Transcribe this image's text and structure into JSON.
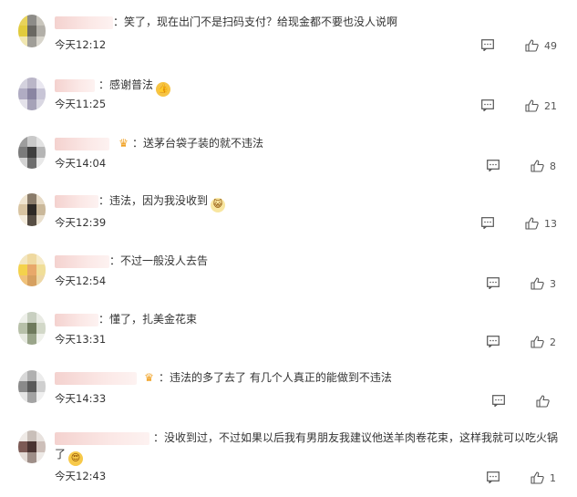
{
  "comments": [
    {
      "sep": "：",
      "text": "笑了，现在出门不是扫码支付？给现金都不要也没人说啊",
      "time": "今天12:12",
      "likes": "49"
    },
    {
      "sep": "：",
      "text": "感谢普法",
      "time": "今天11:25",
      "likes": "21"
    },
    {
      "sep": "：",
      "text": "送茅台袋子装的就不违法",
      "time": "今天14:04",
      "likes": "8"
    },
    {
      "sep": "：",
      "text": "违法，因为我没收到",
      "time": "今天12:39",
      "likes": "13"
    },
    {
      "sep": "：",
      "text": "不过一般没人去告",
      "time": "今天12:54",
      "likes": "3"
    },
    {
      "sep": "：",
      "text": "懂了，扎美金花束",
      "time": "今天13:31",
      "likes": "2"
    },
    {
      "sep": "：",
      "text": "违法的多了去了 有几个人真正的能做到不违法",
      "time": "今天14:33",
      "likes": ""
    },
    {
      "sep": "：",
      "text": "没收到过，不过如果以后我有男朋友我建议他送羊肉卷花束，这样我就可以吃火锅",
      "text2": "了",
      "time": "今天12:43",
      "likes": "1"
    }
  ],
  "icons": {
    "reply": "comment-icon",
    "like": "thumbs-up-icon",
    "crown": "crown-badge-icon"
  }
}
